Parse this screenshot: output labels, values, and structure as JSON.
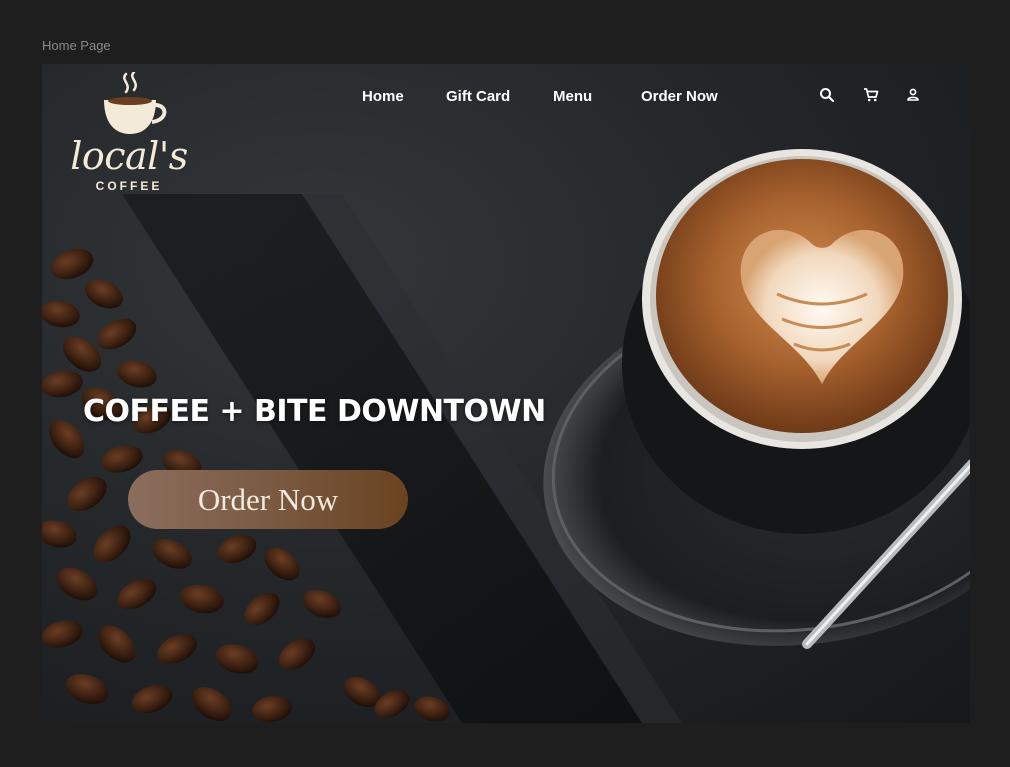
{
  "frame": {
    "label": "Home Page"
  },
  "brand": {
    "wordmark": "local's",
    "subtitle": "COFFEE"
  },
  "nav": {
    "items": [
      {
        "label": "Home"
      },
      {
        "label": "Gift Card"
      },
      {
        "label": "Menu"
      },
      {
        "label": "Order Now"
      }
    ],
    "icons": [
      "search-icon",
      "cart-icon",
      "user-icon"
    ]
  },
  "hero": {
    "headline": "COFFEE + BITE DOWNTOWN",
    "cta_label": "Order Now"
  },
  "colors": {
    "page_background": "#1e1e1e",
    "brand_cream": "#f4ead8",
    "cta_start": "#8c6e5e",
    "cta_end": "#6a4320",
    "crema": "#b8703a"
  }
}
